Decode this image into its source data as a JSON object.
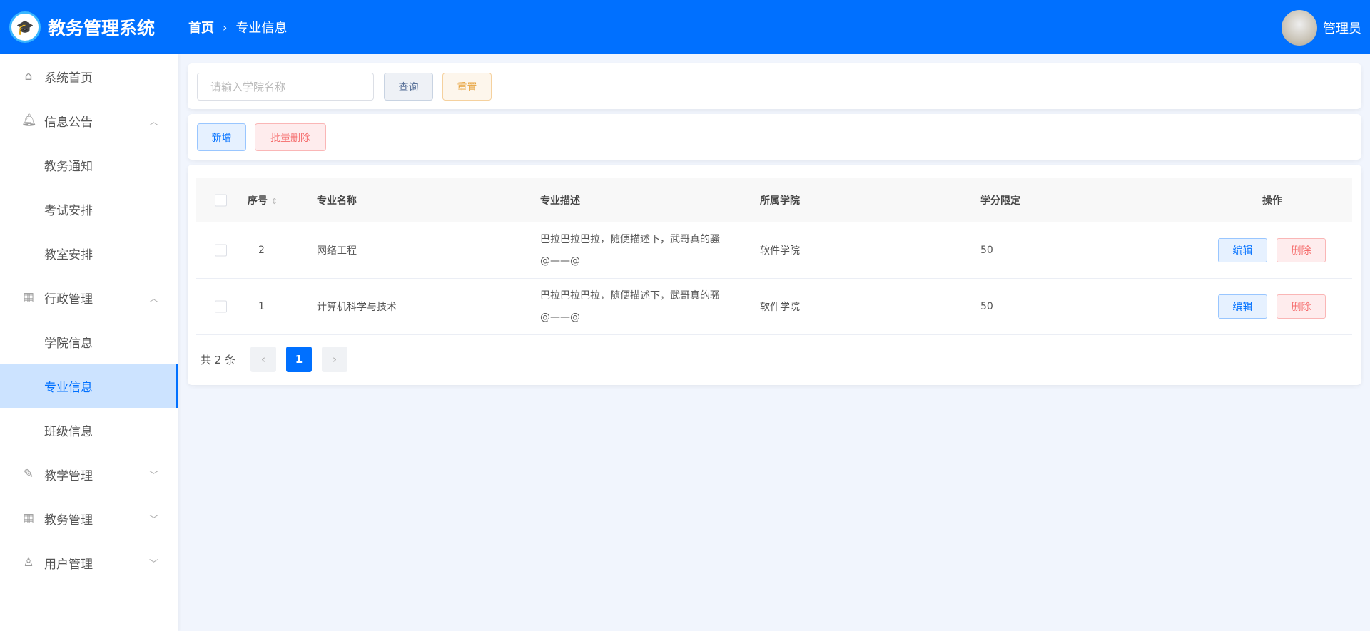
{
  "header": {
    "title": "教务管理系统",
    "breadcrumb": [
      "首页",
      "专业信息"
    ],
    "user": "管理员"
  },
  "sidebar": {
    "items": [
      {
        "label": "系统首页",
        "icon": "home-icon",
        "type": "top"
      },
      {
        "label": "信息公告",
        "icon": "bell-icon",
        "type": "group",
        "arrow": "up"
      },
      {
        "label": "教务通知",
        "type": "sub"
      },
      {
        "label": "考试安排",
        "type": "sub"
      },
      {
        "label": "教室安排",
        "type": "sub"
      },
      {
        "label": "行政管理",
        "icon": "building-icon",
        "type": "group",
        "arrow": "up"
      },
      {
        "label": "学院信息",
        "type": "sub"
      },
      {
        "label": "专业信息",
        "type": "sub",
        "active": true
      },
      {
        "label": "班级信息",
        "type": "sub"
      },
      {
        "label": "教学管理",
        "icon": "edit-icon",
        "type": "group",
        "arrow": "down"
      },
      {
        "label": "教务管理",
        "icon": "calendar-icon",
        "type": "group",
        "arrow": "down"
      },
      {
        "label": "用户管理",
        "icon": "user-icon",
        "type": "group",
        "arrow": "down"
      }
    ]
  },
  "search": {
    "placeholder": "请输入学院名称",
    "query": "查询",
    "reset": "重置"
  },
  "actions": {
    "add": "新增",
    "batch_delete": "批量删除"
  },
  "table": {
    "columns": [
      "序号",
      "专业名称",
      "专业描述",
      "所属学院",
      "学分限定",
      "操作"
    ],
    "rows": [
      {
        "id": "2",
        "name": "网络工程",
        "desc1": "巴拉巴拉巴拉，随便描述下，武哥真的骚",
        "desc2": "@——@",
        "college": "软件学院",
        "credits": "50"
      },
      {
        "id": "1",
        "name": "计算机科学与技术",
        "desc1": "巴拉巴拉巴拉，随便描述下，武哥真的骚",
        "desc2": "@——@",
        "college": "软件学院",
        "credits": "50"
      }
    ],
    "edit": "编辑",
    "delete": "删除"
  },
  "pagination": {
    "total": "共 2 条",
    "current": "1",
    "prev": "‹",
    "next": "›"
  },
  "colors": {
    "primary": "#0070ff",
    "danger": "#f56c6c",
    "warning": "#e6a23c"
  }
}
